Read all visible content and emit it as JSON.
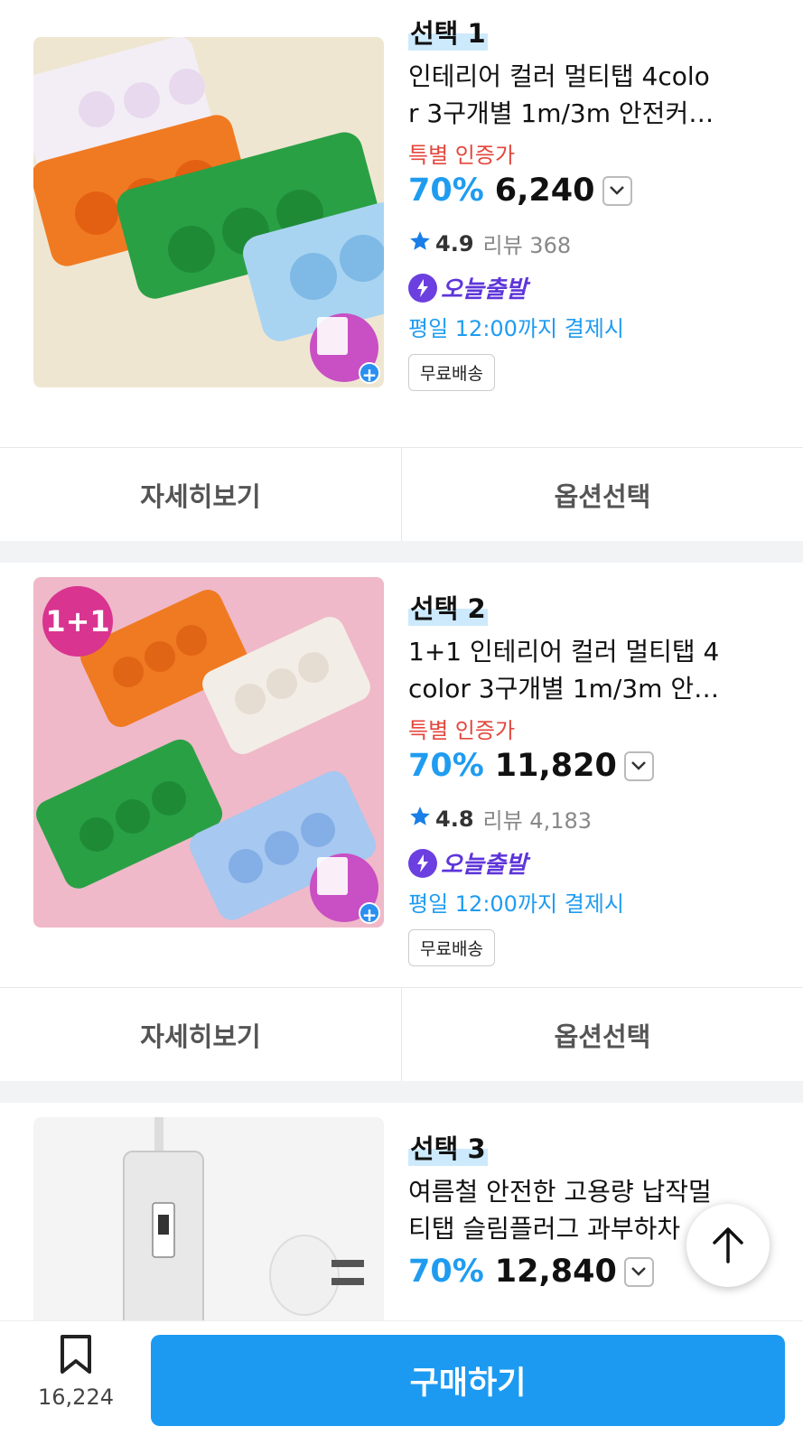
{
  "products": [
    {
      "select_label": "선택 1",
      "title_line1": "인테리어 컬러 멀티탭 4colo",
      "title_line2": "r 3구개별 1m/3m 안전커…",
      "special_label": "특별 인증가",
      "discount": "70%",
      "price": "6,240",
      "rating": "4.9",
      "review_label": "리뷰 368",
      "today_label": "오늘출발",
      "deadline": "평일 12:00까지 결제시",
      "free_shipping": "무료배송"
    },
    {
      "select_label": "선택 2",
      "badge": "1+1",
      "title_line1": "1+1 인테리어 컬러 멀티탭 4",
      "title_line2": "color 3구개별 1m/3m 안…",
      "special_label": "특별 인증가",
      "discount": "70%",
      "price": "11,820",
      "rating": "4.8",
      "review_label": "리뷰 4,183",
      "today_label": "오늘출발",
      "deadline": "평일 12:00까지 결제시",
      "free_shipping": "무료배송"
    },
    {
      "select_label": "선택 3",
      "title_line1": "여름철 안전한 고용량 납작멀",
      "title_line2": "티탭 슬림플러그 과부하차",
      "discount": "70%",
      "price": "12,840"
    }
  ],
  "actions": {
    "detail": "자세히보기",
    "option": "옵션선택"
  },
  "bottom_bar": {
    "save_count": "16,224",
    "buy_label": "구매하기"
  },
  "colors": {
    "accent": "#1c9af2",
    "discount": "#1f9cf0",
    "special": "#e4463c",
    "today": "#5e35d9"
  }
}
